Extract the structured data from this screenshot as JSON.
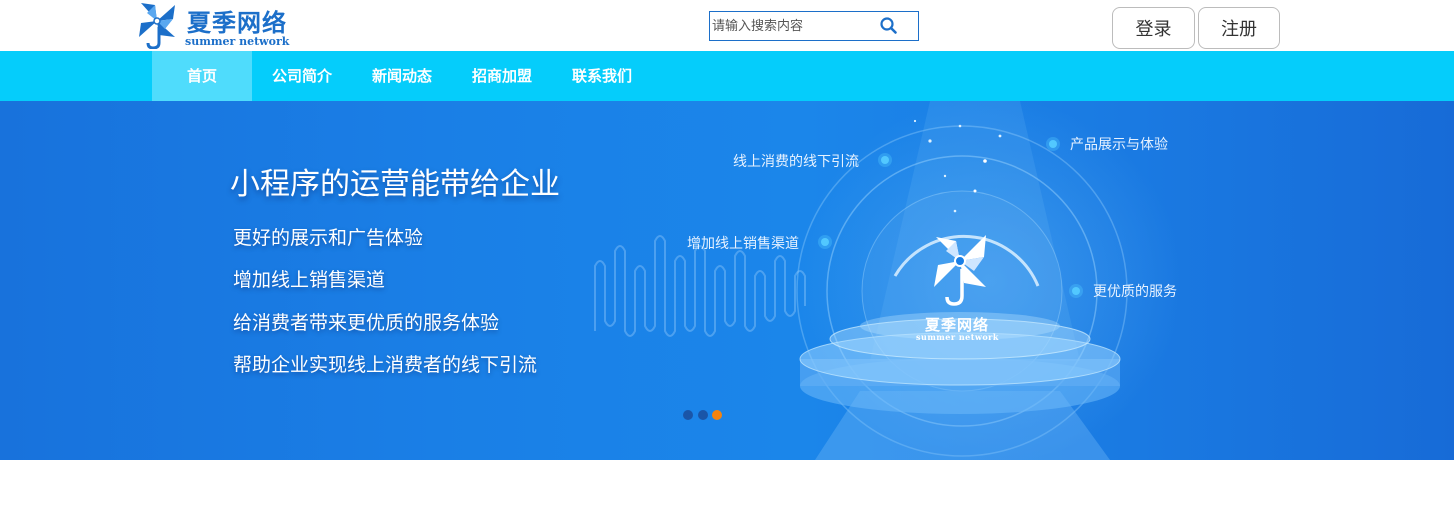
{
  "header": {
    "logo_cn": "夏季网络",
    "logo_en": "summer network",
    "search_placeholder": "请输入搜索内容",
    "login_label": "登录",
    "register_label": "注册"
  },
  "nav": {
    "items": [
      "首页",
      "公司简介",
      "新闻动态",
      "招商加盟",
      "联系我们"
    ],
    "active_index": 0
  },
  "banner": {
    "slogan": "小程序的运营能带给企业",
    "points": [
      "更好的展示和广告体验",
      "增加线上销售渠道",
      "给消费者带来更优质的服务体验",
      "帮助企业实现线上消费者的线下引流"
    ],
    "features": [
      "线上消费的线下引流",
      "产品展示与体验",
      "增加线上销售渠道",
      "更优质的服务"
    ],
    "center_logo_cn": "夏季网络",
    "center_logo_en": "summer network",
    "slides_count": 3,
    "active_slide": 3
  },
  "colors": {
    "brand_blue": "#1c6fc9",
    "nav_bg": "#05cdfb",
    "nav_active_bg": "#4fdcfc",
    "pager_active": "#f5830f"
  },
  "icons": [
    "pinwheel-logo-icon",
    "search-icon"
  ]
}
